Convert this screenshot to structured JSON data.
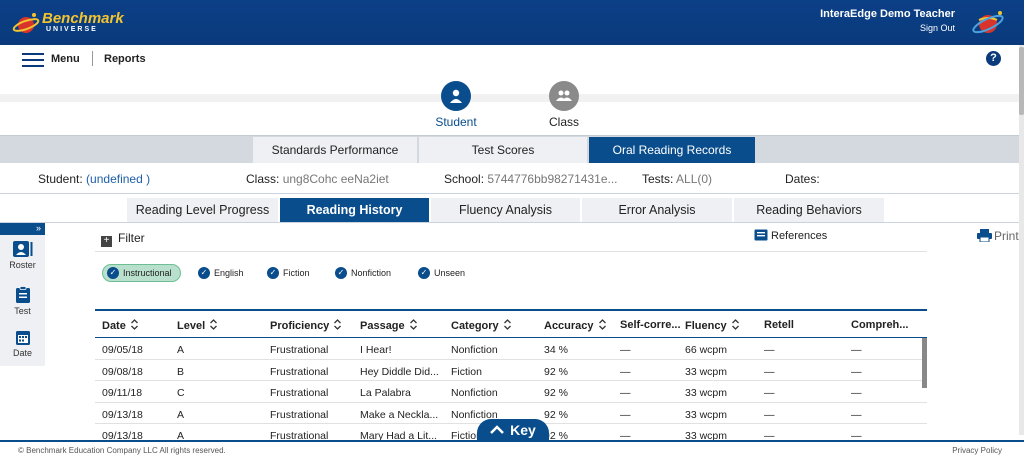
{
  "header": {
    "brand": "Benchmark",
    "brand_sub": "UNIVERSE",
    "user_name": "InteraEdge Demo Teacher",
    "sign_out": "Sign Out"
  },
  "menubar": {
    "menu": "Menu",
    "reports": "Reports",
    "help": "?"
  },
  "views": {
    "student": "Student",
    "class": "Class"
  },
  "report_tabs": [
    "Standards Performance",
    "Test Scores",
    "Oral Reading Records"
  ],
  "info": {
    "student_label": "Student:",
    "student_value": "(undefined )",
    "class_label": "Class:",
    "class_value": "ung8Cohc eeNa2iet",
    "school_label": "School:",
    "school_value": "5744776bb98271431e...",
    "tests_label": "Tests:",
    "tests_value": "ALL(0)",
    "dates_label": "Dates:"
  },
  "sub_tabs": [
    "Reading Level Progress",
    "Reading History",
    "Fluency Analysis",
    "Error Analysis",
    "Reading Behaviors"
  ],
  "left_nav": {
    "toggle": "»",
    "roster": "Roster",
    "test": "Test",
    "date": "Date"
  },
  "toolbar": {
    "filter": "Filter",
    "references": "References",
    "print": "Print"
  },
  "chips": [
    "Instructional",
    "English",
    "Fiction",
    "Nonfiction",
    "Unseen"
  ],
  "table": {
    "headers": [
      "Date",
      "Level",
      "Proficiency",
      "Passage",
      "Category",
      "Accuracy",
      "Self-corre...",
      "Fluency",
      "Retell",
      "Compreh..."
    ],
    "rows": [
      [
        "09/05/18",
        "A",
        "Frustrational",
        "I Hear!",
        "Nonfiction",
        "34 %",
        "—",
        "66 wcpm",
        "—",
        "—"
      ],
      [
        "09/08/18",
        "B",
        "Frustrational",
        "Hey Diddle Did...",
        "Fiction",
        "92 %",
        "—",
        "33 wcpm",
        "—",
        "—"
      ],
      [
        "09/11/18",
        "C",
        "Frustrational",
        "La Palabra",
        "Nonfiction",
        "92 %",
        "—",
        "33 wcpm",
        "—",
        "—"
      ],
      [
        "09/13/18",
        "A",
        "Frustrational",
        "Make a Neckla...",
        "Nonfiction",
        "92 %",
        "—",
        "33 wcpm",
        "—",
        "—"
      ],
      [
        "09/13/18",
        "A",
        "Frustrational",
        "Mary Had a Lit...",
        "Fiction",
        "92 %",
        "—",
        "33 wcpm",
        "—",
        "—"
      ]
    ]
  },
  "key_button": "Key",
  "footer": {
    "copyright": "© Benchmark Education Company LLC All rights reserved.",
    "privacy": "Privacy Policy"
  },
  "colors": {
    "primary": "#0a4d8c",
    "header": "#0a3a7c",
    "chip_active": "#b8e0cc"
  }
}
